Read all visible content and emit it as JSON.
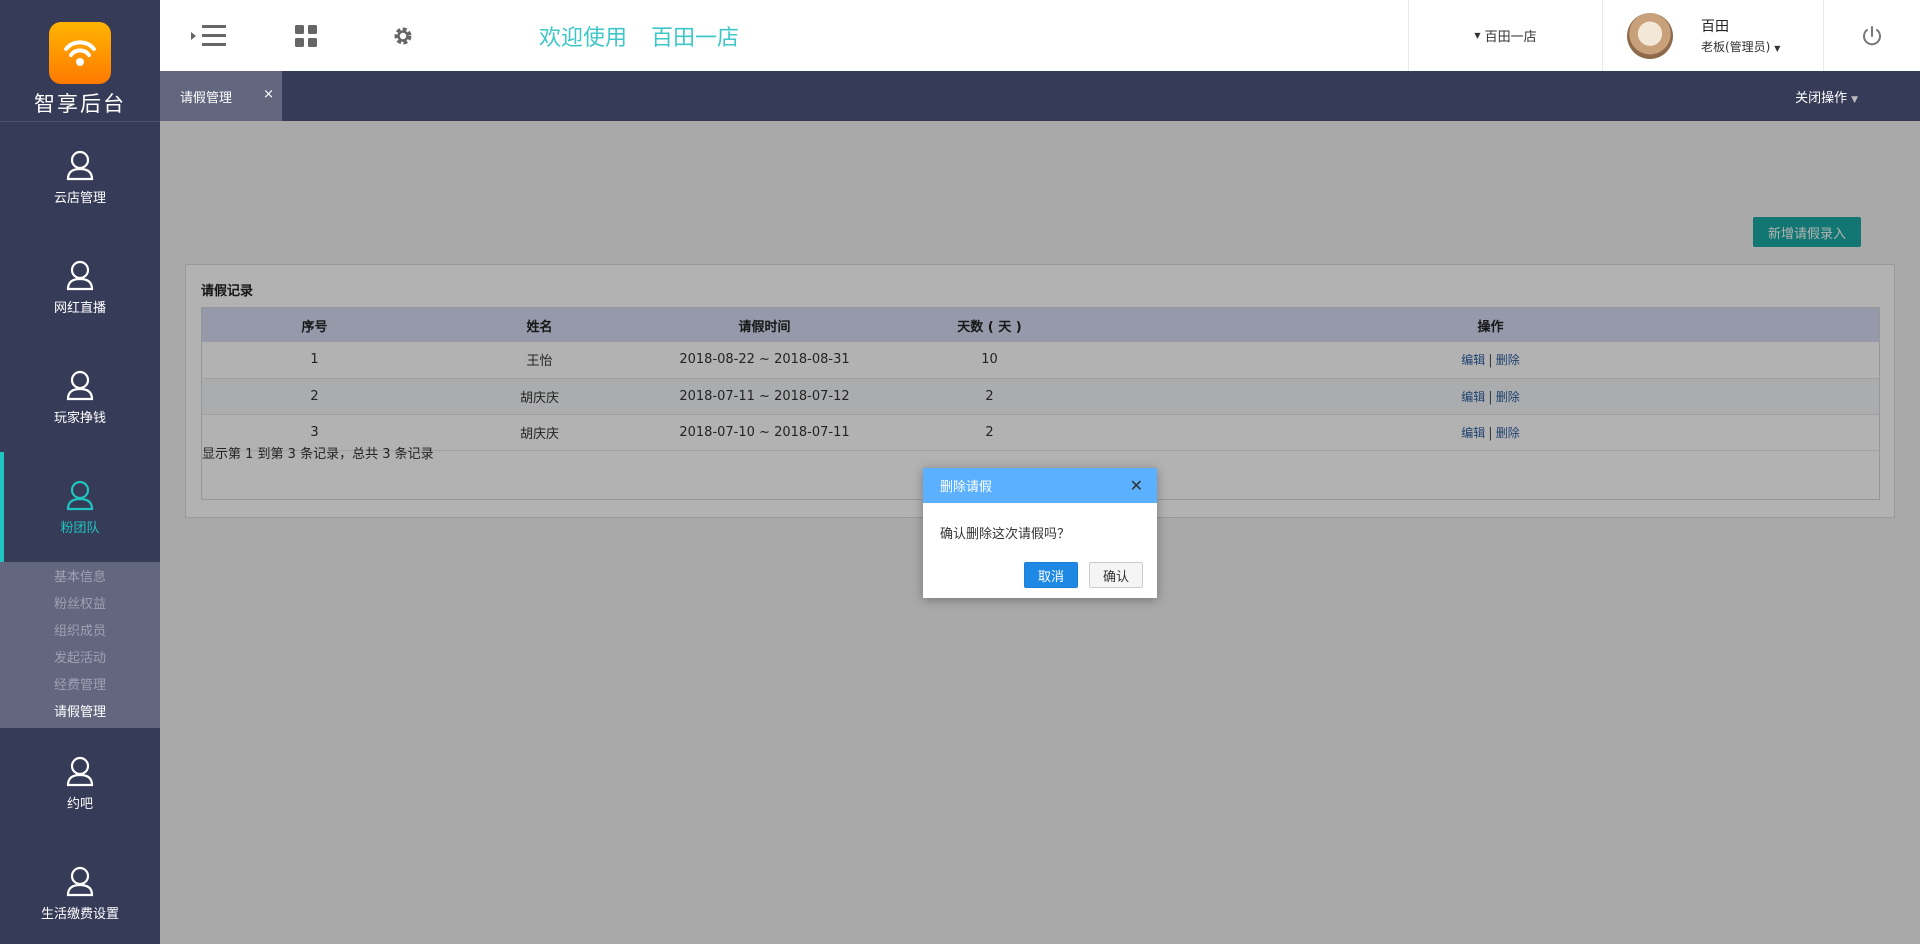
{
  "brand": {
    "logo_text": "智享后台",
    "accent": "#1fc4c0"
  },
  "sidebar": {
    "items": [
      {
        "label": "云店管理",
        "icon": "user-icon"
      },
      {
        "label": "网红直播",
        "icon": "user-icon"
      },
      {
        "label": "玩家挣钱",
        "icon": "user-icon"
      },
      {
        "label": "粉团队",
        "icon": "user-icon",
        "active": true
      },
      {
        "label": "约吧",
        "icon": "user-icon"
      },
      {
        "label": "生活缴费设置",
        "icon": "user-icon"
      }
    ],
    "submenu": [
      "基本信息",
      "粉丝权益",
      "组织成员",
      "发起活动",
      "经费管理",
      "请假管理"
    ]
  },
  "header": {
    "welcome": "欢迎使用",
    "store_name": "百田一店",
    "store_select": "百田一店",
    "user_name": "百田",
    "user_role": "老板(管理员)"
  },
  "tabbar": {
    "tab_label": "请假管理",
    "tab_close": "×",
    "close_ops": "关闭操作"
  },
  "content": {
    "add_button": "新增请假录入",
    "panel_title": "请假记录",
    "columns": [
      "序号",
      "姓名",
      "请假时间",
      "天数 ( 天 )",
      "操作"
    ],
    "rows": [
      {
        "no": "1",
        "name": "王怡",
        "period": "2018-08-22 ~ 2018-08-31",
        "days": "10"
      },
      {
        "no": "2",
        "name": "胡庆庆",
        "period": "2018-07-11 ~ 2018-07-12",
        "days": "2"
      },
      {
        "no": "3",
        "name": "胡庆庆",
        "period": "2018-07-10 ~ 2018-07-11",
        "days": "2"
      }
    ],
    "edit_label": "编辑",
    "delete_label": "删除",
    "separator": "|",
    "footer_info": "显示第 1 到第 3 条记录，总共 3 条记录"
  },
  "modal": {
    "title": "删除请假",
    "close": "✕",
    "message": "确认删除这次请假吗？",
    "cancel": "取消",
    "confirm": "确认"
  }
}
